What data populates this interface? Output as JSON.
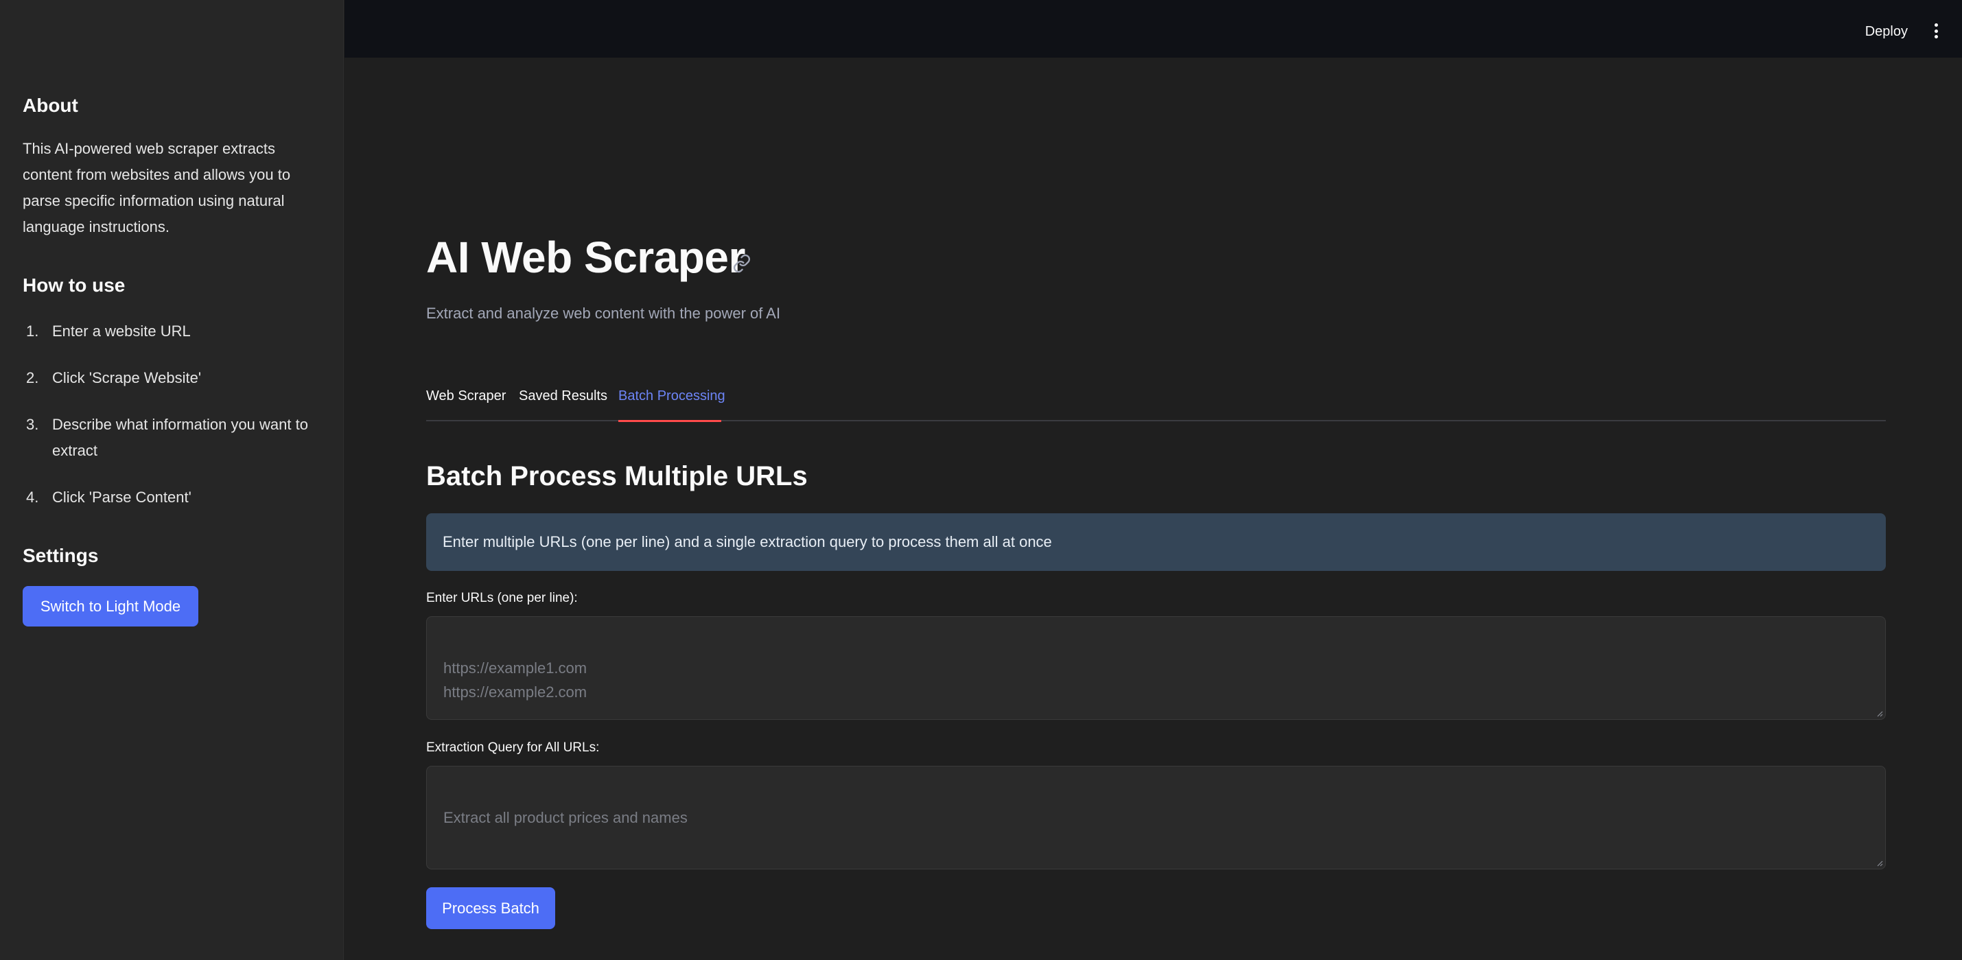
{
  "sidebar": {
    "about_heading": "About",
    "about_text": "This AI-powered web scraper extracts content from websites and allows you to parse specific information using natural language instructions.",
    "howto_heading": "How to use",
    "steps": [
      {
        "num": "1.",
        "text": "Enter a website URL"
      },
      {
        "num": "2.",
        "text": "Click 'Scrape Website'"
      },
      {
        "num": "3.",
        "text": "Describe what information you want to extract"
      },
      {
        "num": "4.",
        "text": "Click 'Parse Content'"
      }
    ],
    "settings_heading": "Settings",
    "theme_button": "Switch to Light Mode"
  },
  "topbar": {
    "deploy_label": "Deploy",
    "menu_icon": "kebab-menu-icon"
  },
  "main": {
    "title": "AI Web Scraper",
    "title_icon": "link-icon",
    "subtitle": "Extract and analyze web content with the power of AI",
    "tabs": [
      {
        "label": "Web Scraper",
        "active": false
      },
      {
        "label": "Saved Results",
        "active": false
      },
      {
        "label": "Batch Processing",
        "active": true
      }
    ],
    "section_heading": "Batch Process Multiple URLs",
    "info_text": "Enter multiple URLs (one per line) and a single extraction query to process them all at once",
    "urls_label": "Enter URLs (one per line):",
    "urls_placeholder": "https://example1.com\nhttps://example2.com",
    "query_label": "Extraction Query for All URLs:",
    "query_placeholder": "Extract all product prices and names",
    "process_button": "Process Batch"
  },
  "colors": {
    "accent": "#4d6df5",
    "active_tab_text": "#6d85f7",
    "tab_indicator": "#ff4b4b",
    "info_bg": "#344557",
    "background": "#1f1f1f",
    "sidebar_bg": "#262626"
  }
}
